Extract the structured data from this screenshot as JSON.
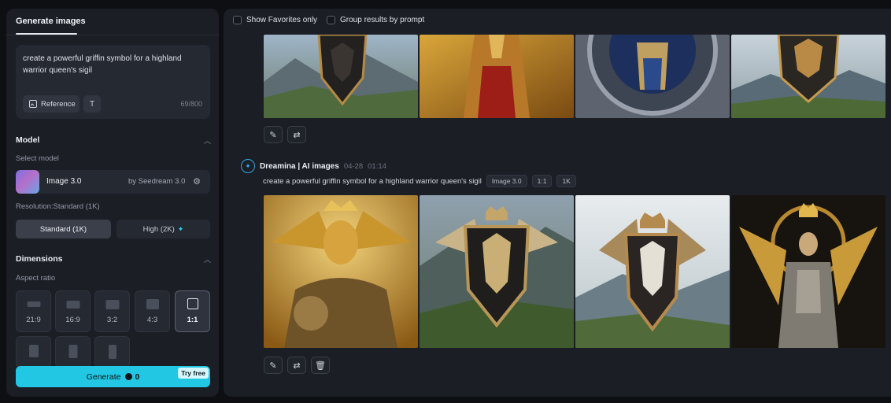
{
  "left_panel": {
    "tab_label": "Generate images",
    "prompt": "create a powerful griffin symbol for a highland warrior queen's sigil",
    "reference_label": "Reference",
    "text_tool_label": "T",
    "char_count": "69/800",
    "model_section": "Model",
    "select_model_label": "Select model",
    "model_name": "Image 3.0",
    "model_by": "by Seedream 3.0",
    "resolution_label": "Resolution:Standard (1K)",
    "res_standard": "Standard (1K)",
    "res_high": "High (2K)",
    "dimensions_section": "Dimensions",
    "aspect_label": "Aspect ratio",
    "ratios": [
      "21:9",
      "16:9",
      "3:2",
      "4:3",
      "1:1"
    ],
    "selected_ratio": "1:1",
    "generate_label": "Generate",
    "generate_cost": "0",
    "try_free": "Try free"
  },
  "right_panel": {
    "show_favorites": "Show Favorites only",
    "group_by_prompt": "Group results by prompt",
    "generation": {
      "source": "Dreamina | AI images",
      "date": "04-28",
      "time": "01:14",
      "prompt": "create a powerful griffin symbol for a highland warrior queen's sigil",
      "tags": [
        "Image 3.0",
        "1:1",
        "1K"
      ]
    }
  },
  "colors": {
    "accent": "#22c7e3",
    "panel": "#1b1e25",
    "background": "#0d0f13"
  }
}
